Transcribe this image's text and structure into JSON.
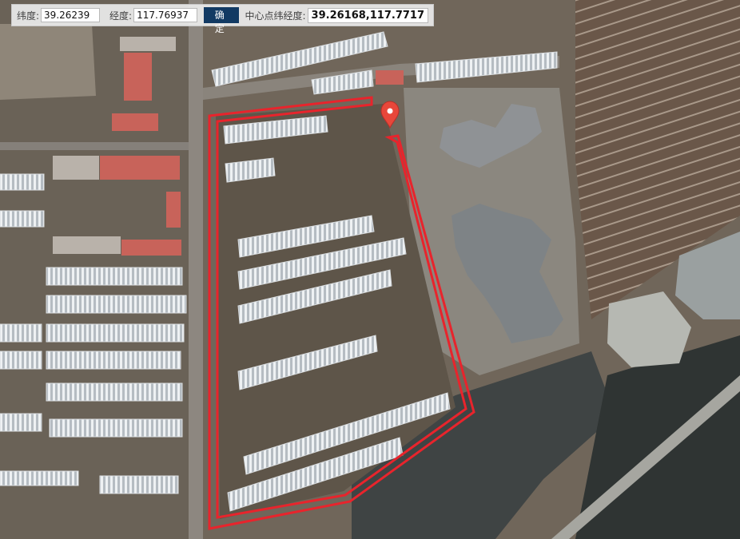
{
  "toolbar": {
    "lat_label": "纬度:",
    "lat_value": "39.26239",
    "lng_label": "经度:",
    "lng_value": "117.76937",
    "confirm_label": "确 定",
    "center_label": "中心点纬经度:",
    "center_value": "39.26168,117.7717"
  },
  "map": {
    "marker_icon": "map-pin-icon",
    "boundary_color": "#e8242c",
    "marker_color": "#e8473a"
  }
}
